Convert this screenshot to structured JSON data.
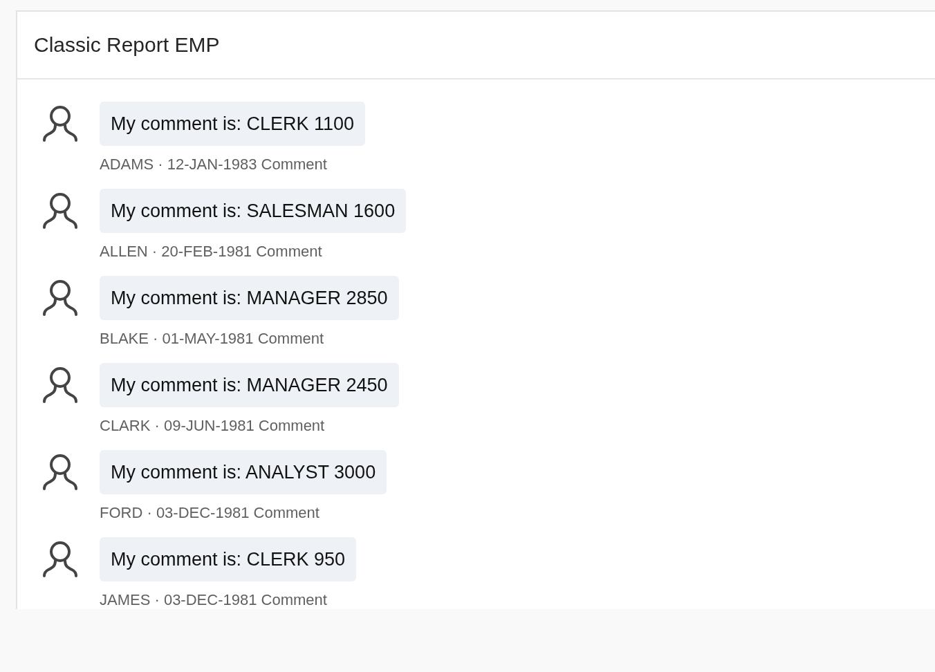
{
  "region": {
    "title": "Classic Report EMP"
  },
  "comments": [
    {
      "text": "My comment is: CLERK 1100",
      "meta": "ADAMS · 12-JAN-1983 Comment"
    },
    {
      "text": "My comment is: SALESMAN 1600",
      "meta": "ALLEN · 20-FEB-1981 Comment"
    },
    {
      "text": "My comment is: MANAGER 2850",
      "meta": "BLAKE · 01-MAY-1981 Comment"
    },
    {
      "text": "My comment is: MANAGER 2450",
      "meta": "CLARK · 09-JUN-1981 Comment"
    },
    {
      "text": "My comment is: ANALYST 3000",
      "meta": "FORD · 03-DEC-1981 Comment"
    },
    {
      "text": "My comment is: CLERK 950",
      "meta": "JAMES · 03-DEC-1981 Comment"
    }
  ]
}
